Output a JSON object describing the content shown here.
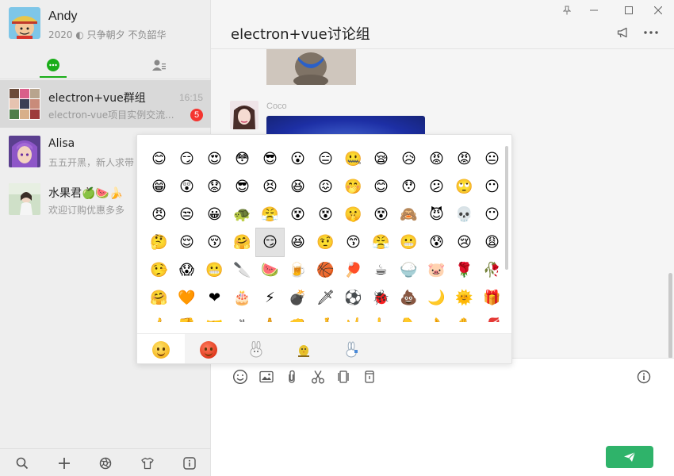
{
  "profile": {
    "name": "Andy",
    "signature": "2020 ◐ 只争朝夕 不负韶华"
  },
  "sessions": [
    {
      "title": "electron+vue群组",
      "preview": "electron-vue项目实例交流...",
      "time": "16:15",
      "badge": "5"
    },
    {
      "title": "Alisa",
      "preview": "五五开黑，新人求带",
      "time": "",
      "badge": ""
    },
    {
      "title": "水果君🍏🍉🍌",
      "preview": "欢迎订购优惠多多",
      "time": "",
      "badge": ""
    }
  ],
  "chat": {
    "title": "electron+vue讨论组",
    "messages": [
      {
        "sender": "Coco"
      }
    ]
  },
  "icons": {
    "chat_tab": "chat-bubble-icon",
    "contacts_tab": "contacts-icon",
    "footer": [
      "search-icon",
      "plus-icon",
      "aperture-icon",
      "tshirt-icon",
      "info-icon"
    ],
    "header": [
      "pin-icon",
      "minimize-icon",
      "maximize-icon",
      "close-icon",
      "megaphone-icon",
      "more-icon"
    ],
    "toolbar": [
      "emoji-icon",
      "image-icon",
      "attachment-icon",
      "scissors-icon",
      "video-icon",
      "cup-icon",
      "info-icon"
    ],
    "send": "send-icon"
  },
  "emoji_panel": {
    "grid": [
      "😊",
      "😏",
      "😍",
      "😳",
      "😎",
      "😮",
      "😑",
      "🤐",
      "😪",
      "😥",
      "😡",
      "😡",
      "😐",
      "😁",
      "😲",
      "😟",
      "😎",
      "😣",
      "😆",
      "😖",
      "🤭",
      "😊",
      "😯",
      "😕",
      "🙄",
      "😶",
      "😠",
      "😒",
      "😀",
      "🐢",
      "😤",
      "😵",
      "😵",
      "🤫",
      "😵",
      "🙈",
      "😈",
      "💀",
      "😶",
      "🤔",
      "😌",
      "😚",
      "🤗",
      "😏",
      "😆",
      "🤨",
      "😙",
      "😤",
      "😬",
      "😰",
      "😢",
      "😩",
      "🤥",
      "😱",
      "😬",
      "🔪",
      "🍉",
      "🍺",
      "🏀",
      "🏓",
      "☕",
      "🍚",
      "🐷",
      "🌹",
      "🥀",
      "🤗",
      "🧡",
      "❤",
      "🎂",
      "⚡",
      "💣",
      "🗡",
      "⚽",
      "🐞",
      "💩",
      "🌙",
      "🌞",
      "🎁",
      "👍",
      "👎",
      "🤝",
      "✌",
      "🙏",
      "👊",
      "🤞",
      "🤘",
      "👆",
      "👇",
      "👌",
      "✋",
      "💋"
    ],
    "selected_index": 43,
    "tabs": [
      "face-emoji-tab",
      "angry-sticker-tab",
      "rabbit-sticker-tab",
      "chick-sticker-tab",
      "bunny-sticker-tab"
    ],
    "active_tab": 0
  },
  "colors": {
    "accent": "#1aad19",
    "send_button": "#2fb36a",
    "badge": "#f43530"
  }
}
